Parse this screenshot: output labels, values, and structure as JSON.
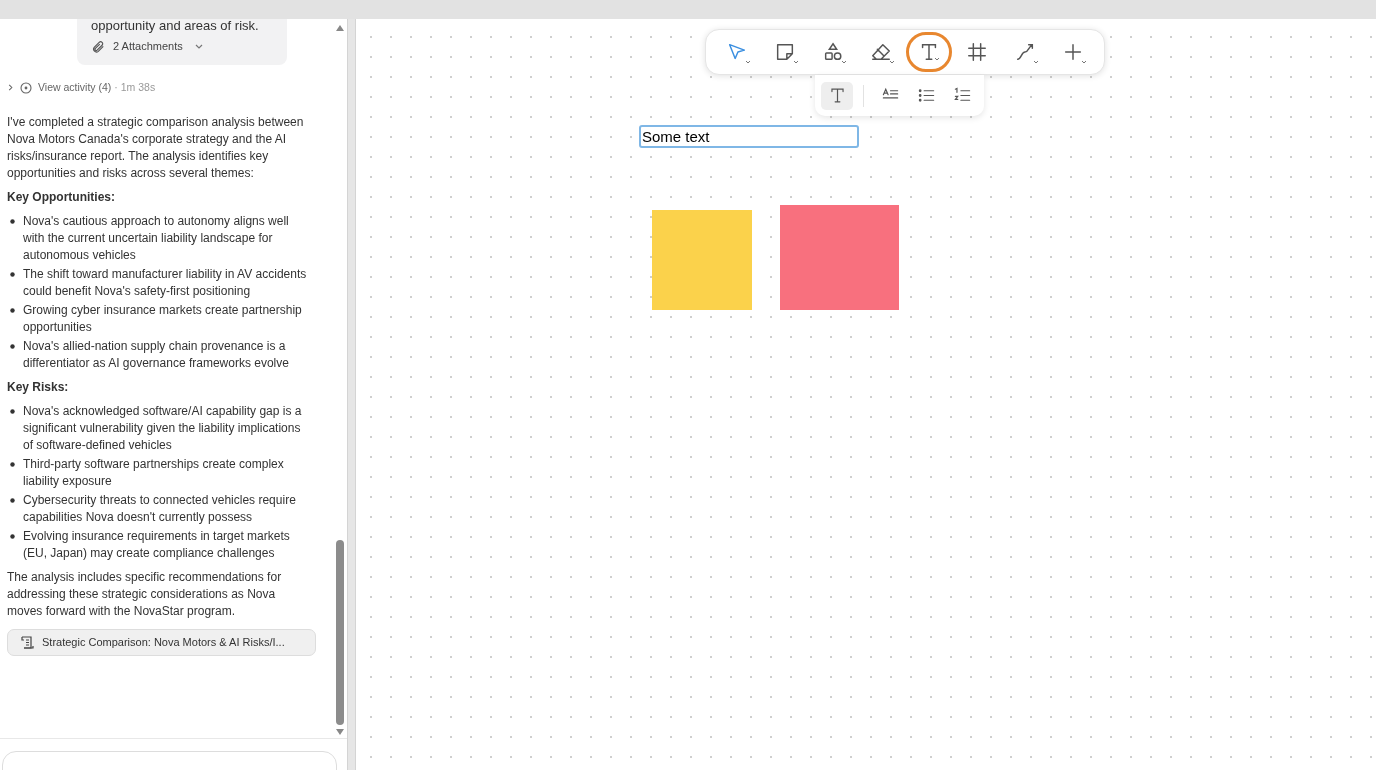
{
  "chat": {
    "request_card": {
      "text": "opportunity and areas of risk.",
      "attachments": "2 Attachments"
    },
    "activity": {
      "label": "View activity (4)",
      "duration": "· 1m 38s",
      "expanded": false
    },
    "reply": {
      "intro": "I've completed a strategic comparison analysis between Nova Motors Canada's corporate strategy and the AI risks/insurance report. The analysis identifies key opportunities and risks across several themes:",
      "sections": [
        {
          "heading": "Key Opportunities:",
          "bullets": [
            "Nova's cautious approach to autonomy aligns well with the current uncertain liability landscape for autonomous vehicles",
            "The shift toward manufacturer liability in AV accidents could benefit Nova's safety-first positioning",
            "Growing cyber insurance markets create partnership opportunities",
            "Nova's allied-nation supply chain provenance is a differentiator as AI governance frameworks evolve"
          ]
        },
        {
          "heading": "Key Risks:",
          "bullets": [
            "Nova's acknowledged software/AI capability gap is a significant vulnerability given the liability implications of software-defined vehicles",
            "Third-party software partnerships create complex liability exposure",
            "Cybersecurity threats to connected vehicles require capabilities Nova doesn't currently possess",
            "Evolving insurance requirements in target markets (EU, Japan) may create compliance challenges"
          ]
        }
      ],
      "closing": "The analysis includes specific recommendations for addressing these strategic considerations as Nova moves forward with the NovaStar program."
    },
    "artifact": "Strategic Comparison: Nova Motors & AI Risks/I..."
  },
  "canvas": {
    "tools": [
      {
        "kind": "select",
        "selected": true,
        "highlighted": false,
        "menu": true
      },
      {
        "kind": "note",
        "selected": false,
        "highlighted": false,
        "menu": true
      },
      {
        "kind": "shapes",
        "selected": false,
        "highlighted": false,
        "menu": true
      },
      {
        "kind": "eraser",
        "selected": false,
        "highlighted": false,
        "menu": true
      },
      {
        "kind": "text",
        "selected": false,
        "highlighted": true,
        "menu": true
      },
      {
        "kind": "frame",
        "selected": false,
        "highlighted": false,
        "menu": false
      },
      {
        "kind": "connector",
        "selected": false,
        "highlighted": false,
        "menu": true
      },
      {
        "kind": "add",
        "selected": false,
        "highlighted": false,
        "menu": true
      }
    ],
    "text_options": [
      {
        "kind": "text",
        "selected": true
      },
      {
        "kind": "style",
        "selected": false
      },
      {
        "kind": "bullets",
        "selected": false
      },
      {
        "kind": "numbered",
        "selected": false
      }
    ],
    "text_box": "Some text",
    "shapes": [
      {
        "color": "#fbd24b"
      },
      {
        "color": "#f8707e"
      }
    ]
  }
}
